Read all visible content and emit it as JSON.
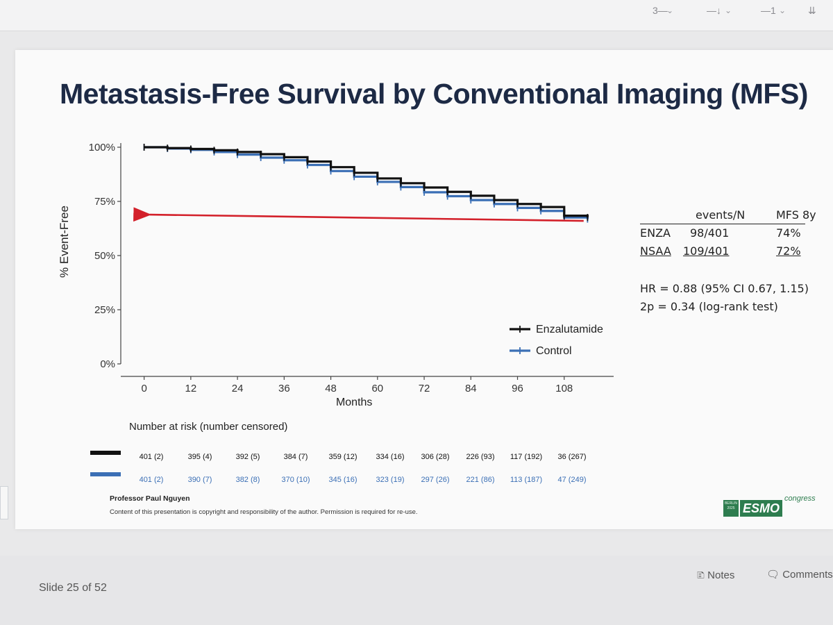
{
  "ribbon": {
    "items": [
      "3—",
      "—↓",
      "—1",
      "⇊"
    ]
  },
  "slide": {
    "title": "Metastasis-Free Survival by Conventional Imaging (MFS)",
    "author": "Professor Paul Nguyen",
    "copyright": "Content of this presentation is copyright and responsibility of the author. Permission is required for re-use.",
    "logo": {
      "small": "BERLIN 2025",
      "word": "ESMO",
      "sub": "congress"
    }
  },
  "chart_data": {
    "type": "line",
    "ylabel": "% Event-Free",
    "xlabel": "Months",
    "yticks": [
      "0%",
      "25%",
      "50%",
      "75%",
      "100%"
    ],
    "ytick_values": [
      0,
      25,
      50,
      75,
      100
    ],
    "xticks": [
      "0",
      "12",
      "24",
      "36",
      "48",
      "60",
      "72",
      "84",
      "96",
      "108"
    ],
    "xtick_values": [
      0,
      12,
      24,
      36,
      48,
      60,
      72,
      84,
      96,
      108
    ],
    "xlim": [
      -6,
      120
    ],
    "ylim": [
      0,
      100
    ],
    "reference_line_y": 66,
    "series": [
      {
        "name": "Enzalutamide",
        "color": "#111111",
        "x": [
          0,
          6,
          12,
          18,
          24,
          30,
          36,
          42,
          48,
          54,
          60,
          66,
          72,
          78,
          84,
          90,
          96,
          102,
          108,
          114
        ],
        "y": [
          100,
          99.6,
          99.2,
          98.6,
          97.8,
          96.8,
          95.4,
          93.4,
          90.8,
          88.2,
          85.6,
          83.4,
          81.4,
          79.4,
          77.6,
          75.6,
          73.8,
          72.4,
          68.4,
          67.6
        ]
      },
      {
        "name": "Control",
        "color": "#3b6fb5",
        "x": [
          0,
          6,
          12,
          18,
          24,
          30,
          36,
          42,
          48,
          54,
          60,
          66,
          72,
          78,
          84,
          90,
          96,
          102,
          108,
          114
        ],
        "y": [
          100,
          99.4,
          98.8,
          97.8,
          96.6,
          95.2,
          94.0,
          91.8,
          89.0,
          86.4,
          84.0,
          81.6,
          79.2,
          77.4,
          75.6,
          73.8,
          72.0,
          70.6,
          67.6,
          66.8
        ]
      }
    ]
  },
  "stats": {
    "header_events": "events/N",
    "header_mfs": "MFS 8y",
    "rows": [
      {
        "arm": "ENZA",
        "events": "98/401",
        "mfs": "74%"
      },
      {
        "arm": "NSAA",
        "events": "109/401",
        "mfs": "72%"
      }
    ],
    "hr": "HR = 0.88 (95% CI 0.67, 1.15)",
    "p": "2p = 0.34 (log-rank test)"
  },
  "risk_table": {
    "title": "Number at risk (number censored)",
    "enza": [
      "401 (2)",
      "395 (4)",
      "392 (5)",
      "384 (7)",
      "359 (12)",
      "334 (16)",
      "306 (28)",
      "226 (93)",
      "117 (192)",
      "36 (267)"
    ],
    "control": [
      "401 (2)",
      "390 (7)",
      "382 (8)",
      "370 (10)",
      "345 (16)",
      "323 (19)",
      "297 (26)",
      "221 (86)",
      "113 (187)",
      "47 (249)"
    ],
    "enza_color": "#111111",
    "control_color": "#3b6fb5"
  },
  "statusbar": {
    "slide_counter": "Slide 25 of 52",
    "notes": "Notes",
    "comments": "Comments"
  }
}
